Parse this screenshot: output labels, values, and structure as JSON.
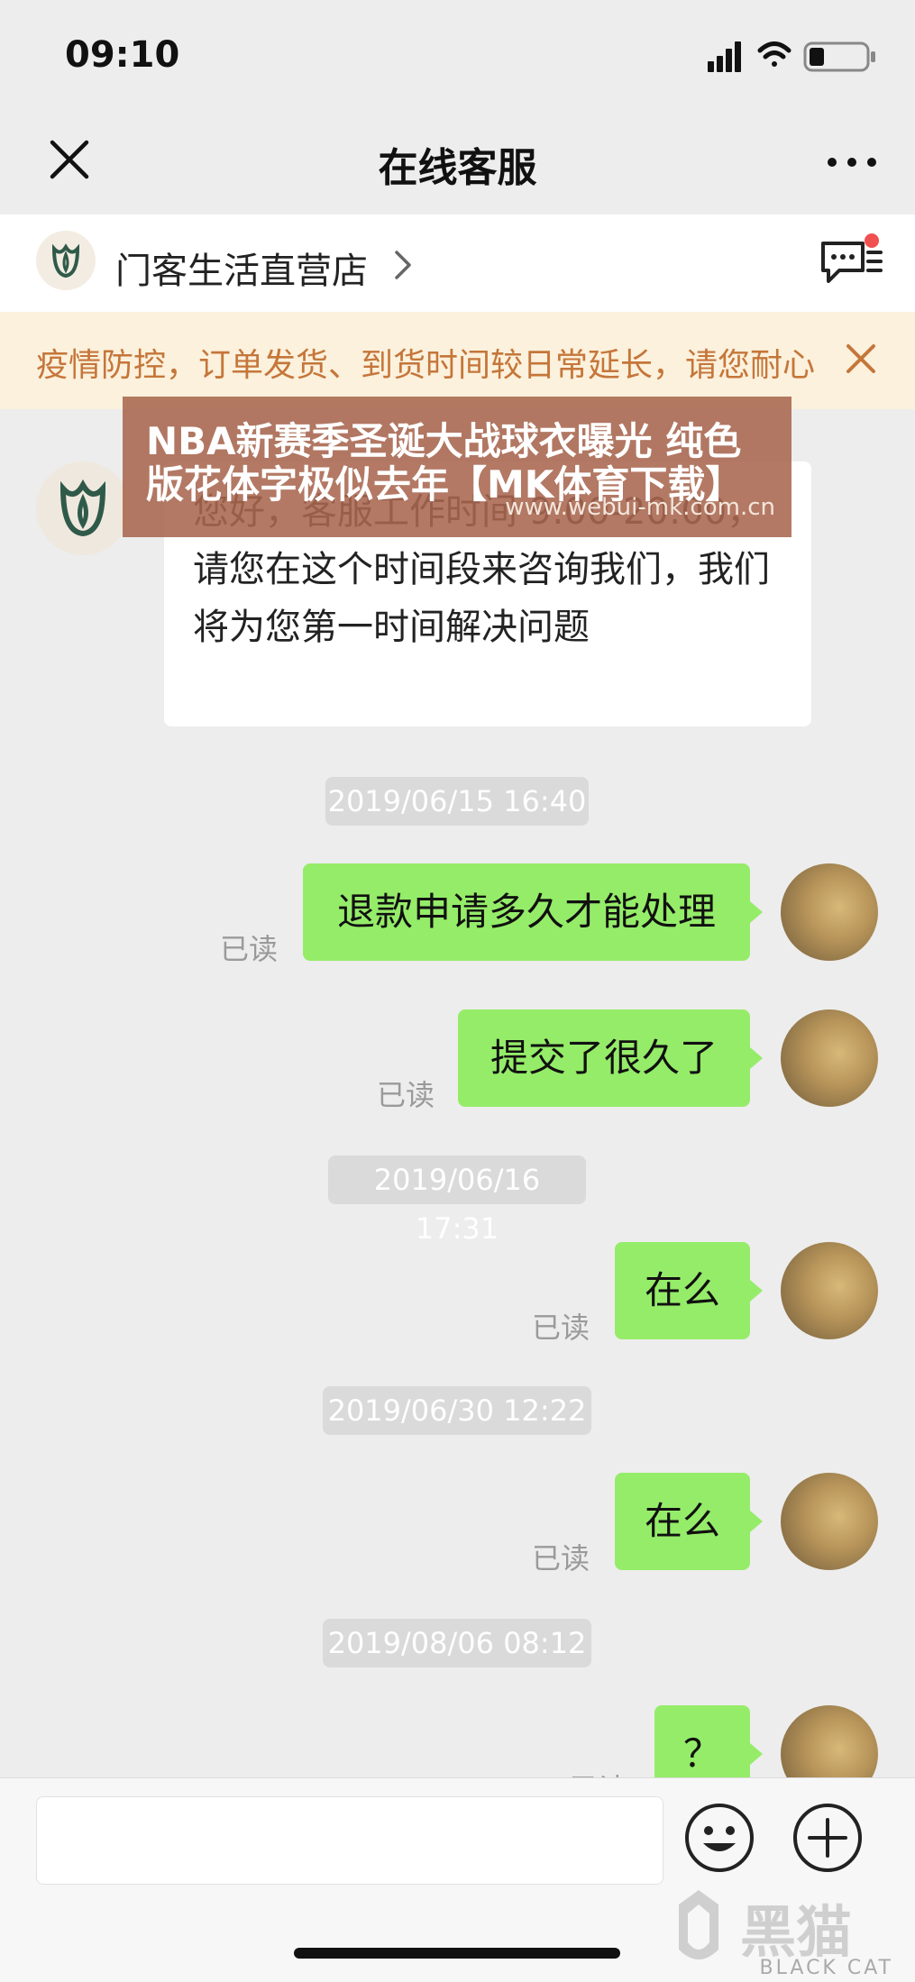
{
  "status_bar": {
    "time": "09:10"
  },
  "nav": {
    "title": "在线客服"
  },
  "store": {
    "name": "门客生活直营店"
  },
  "notice": {
    "text": "疫情防控，订单发货、到货时间较日常延长，请您耐心"
  },
  "watermark": {
    "line1": "NBA新赛季圣诞大战球衣曝光 纯色",
    "line2": "版花体字极似去年【MK体育下载】",
    "url": "www.webui-mk.com.cn"
  },
  "system_message": {
    "text": "您好，客服工作时间 9:00-20:00，请您在这个时间段来咨询我们，我们将为您第一时间解决问题"
  },
  "messages": [
    {
      "time": "2019/06/15 16:40",
      "text": "退款申请多久才能处理",
      "status": "已读"
    },
    {
      "text": "提交了很久了",
      "status": "已读"
    },
    {
      "time": "2019/06/16 17:31",
      "text": "在么",
      "status": "已读"
    },
    {
      "time": "2019/06/30 12:22",
      "text": "在么",
      "status": "已读"
    },
    {
      "time": "2019/08/06 08:12",
      "text": "？",
      "status": "已读"
    }
  ],
  "input": {
    "placeholder": ""
  },
  "branding": {
    "logo_text": "黑猫",
    "logo_sub": "BLACK CAT"
  },
  "colors": {
    "bubble": "#95ec69",
    "notice_text": "#c5763a",
    "notice_bg": "#fbf1dc"
  }
}
